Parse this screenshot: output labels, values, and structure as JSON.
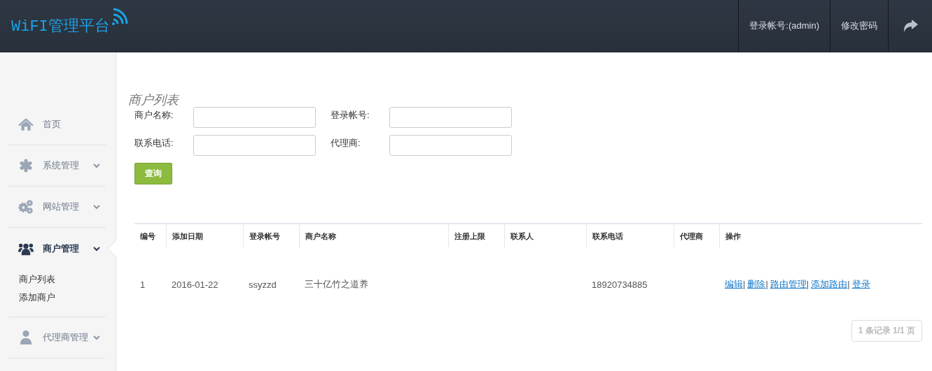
{
  "header": {
    "logo": "WiFI管理平台",
    "account": "登录帐号:(admin)",
    "change_password": "修改密码"
  },
  "sidebar": {
    "items": [
      {
        "label": "首页",
        "kind": "home",
        "expanded": false,
        "selected": false,
        "caret": false
      },
      {
        "label": "系统管理",
        "kind": "asterisk",
        "expanded": false,
        "selected": false,
        "caret": true
      },
      {
        "label": "网站管理",
        "kind": "gears",
        "expanded": false,
        "selected": false,
        "caret": true
      },
      {
        "label": "商户管理",
        "kind": "users",
        "expanded": true,
        "selected": true,
        "caret": true,
        "children": [
          {
            "label": "商户列表"
          },
          {
            "label": "添加商户"
          }
        ]
      },
      {
        "label": "代理商管理",
        "kind": "doctor",
        "expanded": false,
        "selected": false,
        "caret": true
      }
    ]
  },
  "page_title": "商户列表",
  "filters": [
    {
      "label": "商户名称:"
    },
    {
      "label": "登录帐号:"
    },
    {
      "label": "联系电话:"
    },
    {
      "label": "代理商:"
    }
  ],
  "search_button": "查询",
  "table": {
    "columns": [
      "编号",
      "添加日期",
      "登录帐号",
      "商户名称",
      "注册上限",
      "联系人",
      "联系电话",
      "代理商",
      "操作"
    ],
    "rows": [
      {
        "cells": [
          "1",
          "2016-01-22",
          "ssyzzd",
          "三十亿竹之道养",
          "",
          "",
          "18920734885",
          ""
        ],
        "actions": [
          "编辑",
          "删除",
          "路由管理",
          "添加路由",
          "登录"
        ],
        "separator": "|"
      }
    ]
  },
  "pager": {
    "text": "1 条记录 1/1 页",
    "disabled": true
  }
}
